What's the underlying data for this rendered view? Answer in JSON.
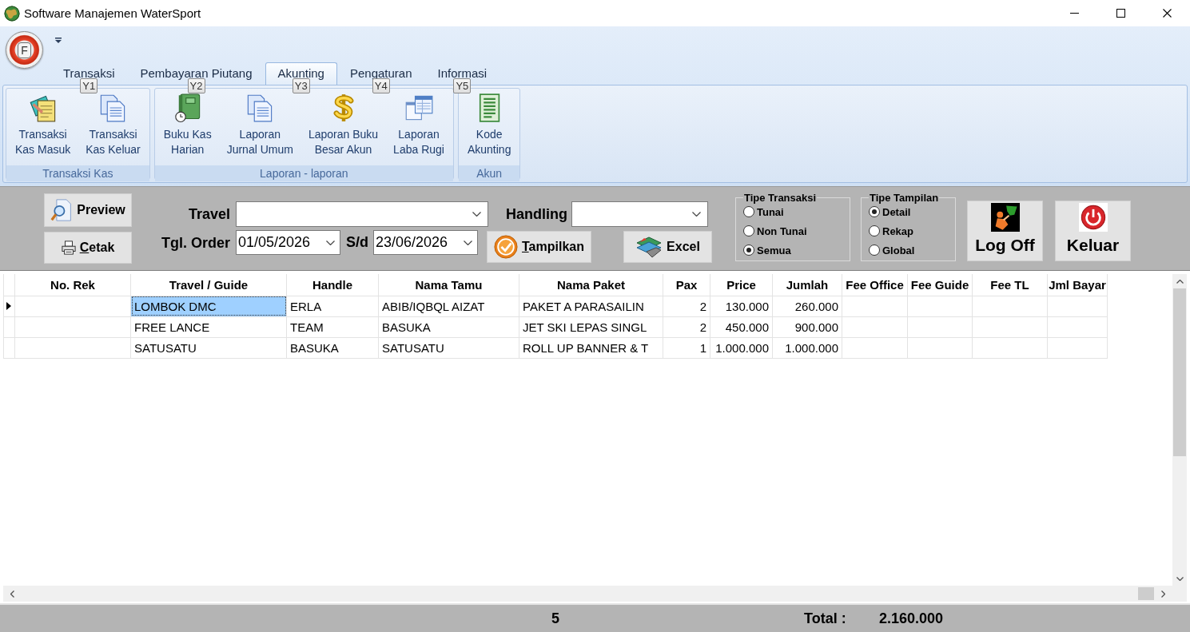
{
  "window": {
    "title": "Software Manajemen WaterSport"
  },
  "app_menu": {
    "label": "F"
  },
  "ribbon": {
    "tabs": [
      {
        "label": "Transaksi",
        "keytip": "Y1",
        "selected": false
      },
      {
        "label": "Pembayaran Piutang",
        "keytip": "Y2",
        "selected": false
      },
      {
        "label": "Akunting",
        "keytip": "Y3",
        "selected": true
      },
      {
        "label": "Pengaturan",
        "keytip": "Y4",
        "selected": false
      },
      {
        "label": "Informasi",
        "keytip": "Y5",
        "selected": false
      }
    ],
    "groups": [
      {
        "caption": "Transaksi Kas",
        "buttons": [
          {
            "kind": "notepad",
            "lines": [
              "Transaksi",
              "Kas Masuk"
            ]
          },
          {
            "kind": "documents",
            "lines": [
              "Transaksi",
              "Kas Keluar"
            ]
          }
        ]
      },
      {
        "caption": "Laporan - laporan",
        "buttons": [
          {
            "kind": "book",
            "lines": [
              "Buku Kas",
              "Harian"
            ]
          },
          {
            "kind": "documents",
            "lines": [
              "Laporan",
              "Jurnal Umum"
            ]
          },
          {
            "kind": "dollar",
            "lines": [
              "Laporan Buku",
              "Besar Akun"
            ]
          },
          {
            "kind": "windows",
            "lines": [
              "Laporan",
              "Laba Rugi"
            ]
          }
        ]
      },
      {
        "caption": "Akun",
        "buttons": [
          {
            "kind": "ledger",
            "lines": [
              "Kode",
              "Akunting"
            ]
          }
        ]
      }
    ]
  },
  "filter": {
    "preview_button": {
      "label": "Preview",
      "mnemonic": false
    },
    "print_button": {
      "label": "Cetak",
      "mnemonic": true
    },
    "travel": {
      "label": "Travel"
    },
    "handling": {
      "label": "Handling"
    },
    "order_date": {
      "label": "Tgl. Order",
      "from": "01/05/2026",
      "until_label": "S/d",
      "until": "23/06/2026"
    },
    "show_button": {
      "label": "Tampilkan",
      "mnemonic": true
    },
    "excel_button": {
      "label": "Excel",
      "mnemonic": false
    },
    "transaction_type": {
      "title": "Tipe Transaksi",
      "options": [
        {
          "label": "Tunai",
          "selected": false
        },
        {
          "label": "Non Tunai",
          "selected": false
        },
        {
          "label": "Semua",
          "selected": true
        }
      ]
    },
    "display_type": {
      "title": "Tipe Tampilan",
      "options": [
        {
          "label": "Detail",
          "selected": true
        },
        {
          "label": "Rekap",
          "selected": false
        },
        {
          "label": "Global",
          "selected": false
        }
      ]
    },
    "logoff_button": {
      "label": "Log Off"
    },
    "exit_button": {
      "label": "Keluar"
    }
  },
  "table": {
    "columns": [
      {
        "label": "No. Rek",
        "current": false
      },
      {
        "label": "Travel / Guide",
        "current": true
      },
      {
        "label": "Handle",
        "current": false
      },
      {
        "label": "Nama Tamu",
        "current": false
      },
      {
        "label": "Nama Paket",
        "current": false
      },
      {
        "label": "Pax",
        "current": false
      },
      {
        "label": "Price",
        "current": false
      },
      {
        "label": "Jumlah",
        "current": false
      },
      {
        "label": "Fee Office",
        "current": false
      },
      {
        "label": "Fee Guide",
        "current": false
      },
      {
        "label": "Fee TL",
        "current": false
      },
      {
        "label": "Jml Bayar",
        "current": false
      }
    ],
    "rows": [
      {
        "selected": true,
        "travel_guide": "LOMBOK DMC",
        "handle": "ERLA",
        "nama_tamu": "ABIB/IQBQL AIZAT",
        "nama_paket": "PAKET A PARASAILIN",
        "pax": "2",
        "price": "130.000",
        "jumlah": "260.000"
      },
      {
        "selected": false,
        "travel_guide": "FREE LANCE",
        "handle": "TEAM",
        "nama_tamu": "BASUKA",
        "nama_paket": "JET SKI LEPAS SINGL",
        "pax": "2",
        "price": "450.000",
        "jumlah": "900.000"
      },
      {
        "selected": false,
        "travel_guide": "SATUSATU",
        "handle": "BASUKA",
        "nama_tamu": "SATUSATU",
        "nama_paket": "ROLL UP BANNER & T",
        "pax": "1",
        "price": "1.000.000",
        "jumlah": "1.000.000"
      }
    ]
  },
  "status_bar": {
    "count": "5",
    "total_label": "Total :",
    "total": "2.160.000"
  }
}
